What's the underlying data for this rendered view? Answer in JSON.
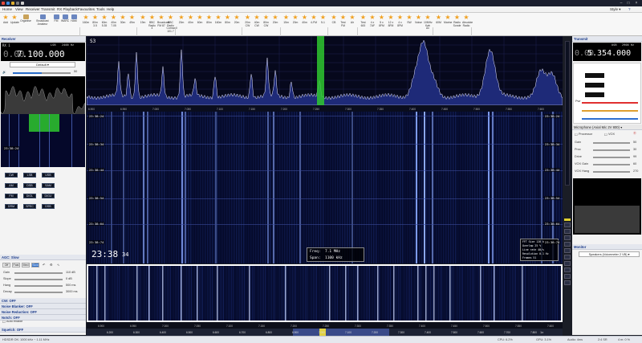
{
  "menubar": {
    "items": [
      "Home",
      "View",
      "Receiver",
      "Transmit",
      "RX Playback",
      "Favourites",
      "Tools",
      "Help"
    ]
  },
  "window": {
    "style_label": "Style"
  },
  "ribbon": {
    "manage": [
      "Add",
      "Update",
      "Organise"
    ],
    "manage_group": "Manage",
    "bands_btns": [
      "Broadcast Amateur",
      "FM",
      "WARC",
      "HAM"
    ],
    "bands_group": "Bands",
    "sw_labels": [
      "160m",
      "80m 3.5",
      "60m 5.35",
      "40m 7.05",
      "30m",
      "49m"
    ],
    "sw_group": "SW",
    "broadcast_labels": [
      "19m",
      "BBC Radio 4",
      "Broadcast FM 87",
      "BBC Radio Cornwall 101.7"
    ],
    "broadcast_group": "FM",
    "ham1_labels": [
      "20m",
      "40m",
      "60m",
      "80m",
      "160m",
      "80m",
      "20m"
    ],
    "ham1_group": "HAM",
    "cw_labels": [
      "20m CW",
      "40m CW",
      "80m CW",
      "20m"
    ],
    "cw_group": "CW",
    "hm2_labels": [
      "15m",
      "20m",
      "40m",
      "4-FM",
      "5-1"
    ],
    "hm2_group": "FM",
    "cb_labels": [
      "CB",
      "Test FM",
      "Air"
    ],
    "cb_group": "CB/B",
    "misc_labels": [
      "Test 600",
      "4 x 7AF",
      "5 x 8FM",
      "12 x 8FM",
      "4 x 8FM",
      "SW",
      "Noise",
      "10MHz Kab Ax"
    ],
    "misc_group": "Matrix",
    "util_labels": [
      "60M",
      "Marine",
      "Radio Sonde",
      "Absolute Radio"
    ],
    "util_group": "LimeSDR"
  },
  "left": {
    "receiver_hdr": "Receiver",
    "rx_label": "RX 1",
    "rx_freq_prefix": "0.00",
    "rx_freq": "7.100.000",
    "rx_mode": "LSB",
    "rx_bw": "2400 Hz",
    "profile": "Default",
    "vol": "50",
    "time_label": "23:38:24",
    "mem_btns": [
      "CW",
      "LSB",
      "USB",
      "AM",
      "DSB",
      "SAM",
      "FM",
      "DIGL",
      "DIGU",
      "DRM",
      "SPEC",
      "DSB"
    ],
    "agc_hdr": "AGC: Slow",
    "agc_btns": [
      "Off",
      "Fast",
      "Med",
      "Slow"
    ],
    "agc_rows": [
      {
        "label": "Gain",
        "value": "110 dB"
      },
      {
        "label": "Slope",
        "value": "0 dB"
      },
      {
        "label": "Hang",
        "value": "500 ms"
      },
      {
        "label": "Decay",
        "value": "3000 ms"
      }
    ],
    "sections": [
      "CW: OFF",
      "Noise Blanker: OFF",
      "Noise Reduction: OFF",
      "Notch: OFF",
      "Squelch: OFF"
    ],
    "auto_enable": "Auto enable"
  },
  "spectrum": {
    "smeter": "S3",
    "ticks": [
      "6.900",
      "6.950",
      "7.000",
      "7.050",
      "7.100",
      "7.150",
      "7.200",
      "7.250",
      "7.300",
      "7.350",
      "7.400",
      "7.450",
      "7.500",
      "7.550",
      "7.600"
    ]
  },
  "waterfall": {
    "times": [
      "23:38:24",
      "23:38:34",
      "23:38:44",
      "23:38:54",
      "23:38:64",
      "23:38:74"
    ],
    "big_time": "23:38",
    "big_sec": "34",
    "freq_label": "Freq:",
    "freq_val": "7.1 MHz",
    "span_label": "Span:",
    "span_val": "1100 kHz",
    "info_rows": [
      "FFT Size 128 k",
      "Overlap 25 %",
      "Line rate 40/s",
      "Resolution 0.1 Hz",
      "Frames 51"
    ]
  },
  "bottom": {
    "ticks": [
      "6.200",
      "6.300",
      "6.400",
      "6.500",
      "6.600",
      "6.700",
      "6.800",
      "6.900",
      "7.000",
      "7.100",
      "7.200",
      "7.300",
      "7.400",
      "7.500",
      "7.600",
      "7.700",
      "7.800"
    ],
    "zoom_label": "1x"
  },
  "right": {
    "transmit_hdr": "Transmit",
    "tx_freq_prefix": "0.00",
    "tx_freq": "5.354.000",
    "tx_mode": "USB",
    "tx_bw": "2900 Hz",
    "mic_hdr": "Microphone (Axial Mic 2V 800)",
    "processor": "Processor",
    "vox": "VOX",
    "rows": [
      {
        "label": "Gain",
        "value": "50"
      },
      {
        "label": "Proc",
        "value": "30"
      },
      {
        "label": "Drive",
        "value": "99"
      },
      {
        "label": "VOX Gain",
        "value": "60"
      },
      {
        "label": "VOX Hang",
        "value": "270"
      }
    ],
    "monitor_hdr": "Monitor",
    "speakers": "Speakers (Voicemeter 2 VB)",
    "power_label": "Pwr"
  },
  "status": {
    "left": "HDSDR OK: 1000 kHz  ~ 1.11 MHz",
    "cpu": "CPU: 6.2%",
    "gpu": "GPU: 3.1%",
    "audio": "Audio: 4ms",
    "rate": "2:4 SR",
    "tx": "4 m: 0 %"
  },
  "colors": {
    "accent": "#2a6cc9",
    "spectrum_fill": "#1e2a78",
    "passband": "#2fc82f"
  }
}
